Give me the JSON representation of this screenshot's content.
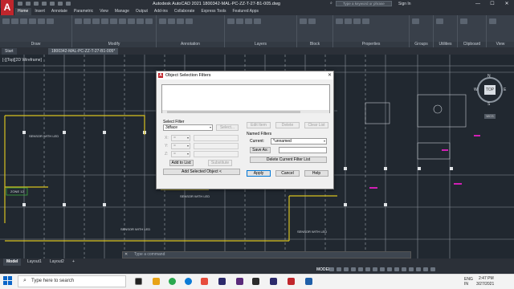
{
  "app": {
    "logo": "A",
    "title": "Autodesk AutoCAD 2021    1800342-MAL-PC-ZZ-T-27-B1-005.dwg"
  },
  "search": {
    "placeholder": "Type a keyword or phrase"
  },
  "signin": "Sign In",
  "window_controls": [
    "—",
    "☐",
    "✕"
  ],
  "ribbon_tabs": [
    "Home",
    "Insert",
    "Annotate",
    "Parametric",
    "View",
    "Manage",
    "Output",
    "Add-ins",
    "Collaborate",
    "Express Tools",
    "Featured Apps"
  ],
  "ribbon_panels": [
    "Draw",
    "Modify",
    "Annotation",
    "Layers",
    "Block",
    "Properties",
    "Groups",
    "Utilities",
    "Clipboard",
    "View"
  ],
  "file_tabs": [
    "Start",
    "1800342-MAL-PC-ZZ-T-27-B1-005*"
  ],
  "viewport_label": "[-][Top][2D Wireframe]",
  "viewcube": {
    "top": "TOP",
    "n": "N",
    "s": "S",
    "e": "E",
    "w": "W",
    "wcs": "WCS"
  },
  "drawing_labels": [
    "SENSOR WITH LED",
    "SENSOR WITH LED",
    "SENSOR WITH LED",
    "SENSOR WITH LED",
    "ZONE 12"
  ],
  "dialog": {
    "title": "Object Selection Filters",
    "select_filter_label": "Select Filter",
    "filter_value": "3dface",
    "select_button": "Select...",
    "x_label": "X:",
    "y_label": "Y:",
    "z_label": "Z:",
    "op_placeholder": "=",
    "add_to_list": "Add to List:",
    "substitute": "Substitute",
    "add_selected": "Add Selected Object <",
    "edit_item": "Edit Item",
    "delete": "Delete",
    "clear_list": "Clear List",
    "named_filters_label": "Named Filters",
    "current_label": "Current:",
    "current_value": "*unnamed",
    "save_as": "Save As:",
    "delete_current": "Delete Current Filter List",
    "apply": "Apply",
    "cancel": "Cancel",
    "help": "Help",
    "close": "✕"
  },
  "command_line": {
    "close": "✕",
    "prompt": "Type a command"
  },
  "layout_tabs": [
    "Model",
    "Layout1",
    "Layout2",
    "+"
  ],
  "status": {
    "model": "MODEL"
  },
  "taskbar": {
    "search_text": "Type here to search",
    "lang1": "ENG",
    "lang2": "IN",
    "time": "2:47 PM",
    "date": "3/27/2021"
  }
}
